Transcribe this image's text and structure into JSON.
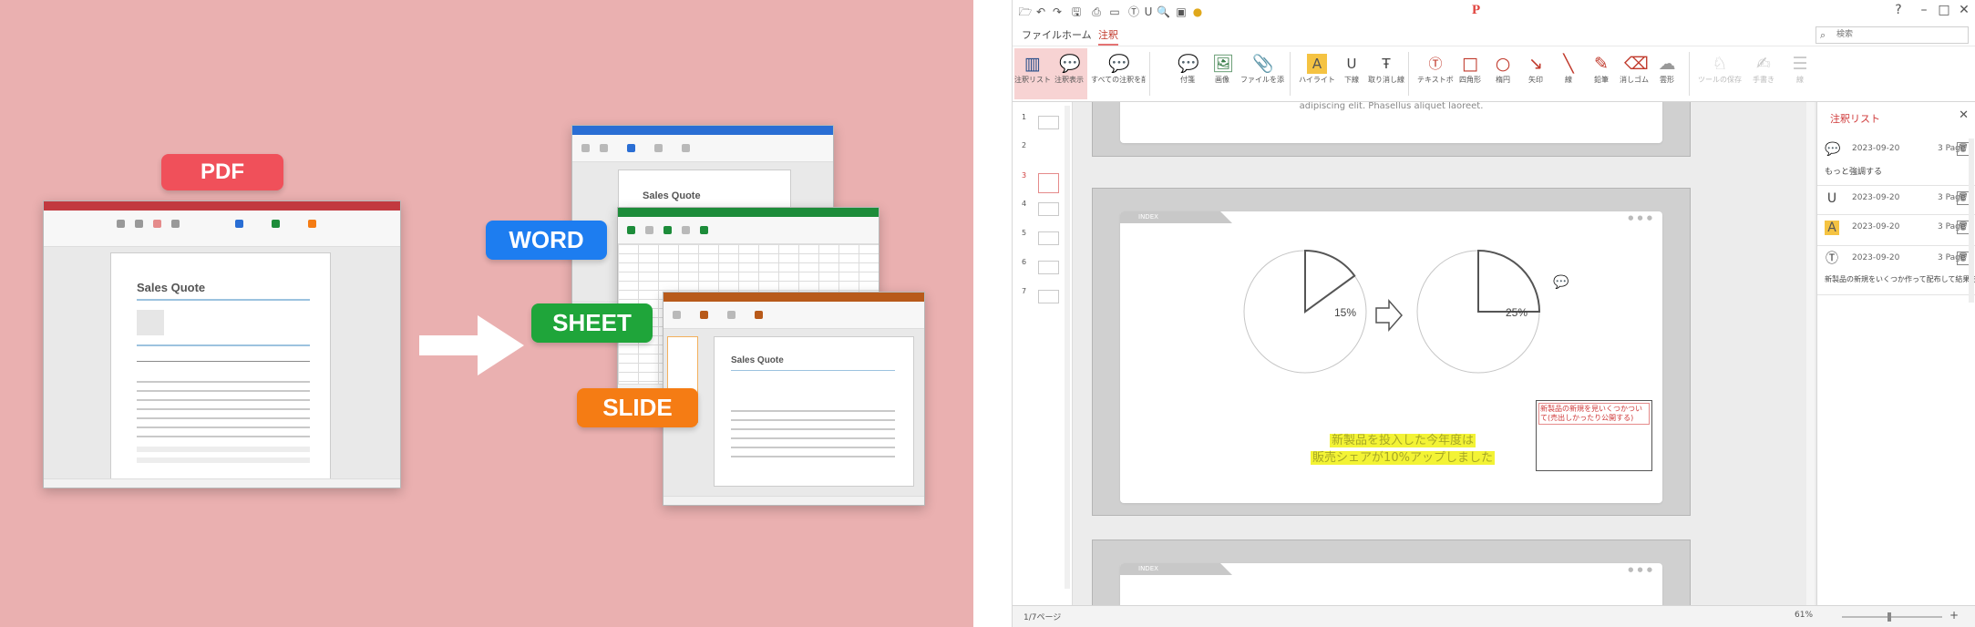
{
  "promo": {
    "badges": {
      "pdf": "PDF",
      "word": "WORD",
      "sheet": "SHEET",
      "slide": "SLIDE"
    },
    "colors": {
      "background": "#eab0b0",
      "pdf": "#f0505a",
      "word": "#1d7df0",
      "sheet": "#1fa53a",
      "slide": "#f57c14"
    },
    "doc_title": "Sales Quote"
  },
  "app": {
    "logo": "P",
    "window_controls": {
      "help": "?",
      "minimize": "–",
      "maximize": "□",
      "close": "✕"
    },
    "tabs": [
      {
        "label": "ファイル"
      },
      {
        "label": "ホーム"
      },
      {
        "label": "注釈"
      }
    ],
    "search_placeholder": "検索",
    "ribbon": [
      {
        "label": "注釈リスト",
        "icon": "annotation-list-icon"
      },
      {
        "label": "注釈表示",
        "icon": "annotation-show-icon"
      },
      {
        "label": "すべての注釈を削除",
        "icon": "delete-all-annotations-icon"
      },
      {
        "label": "付箋",
        "icon": "sticky-note-icon"
      },
      {
        "label": "画像",
        "icon": "image-icon"
      },
      {
        "label": "ファイルを添付",
        "icon": "attach-file-icon"
      },
      {
        "label": "ハイライト",
        "icon": "highlight-icon"
      },
      {
        "label": "下線",
        "icon": "underline-icon"
      },
      {
        "label": "取り消し線",
        "icon": "strikethrough-icon"
      },
      {
        "label": "テキストボックス",
        "icon": "textbox-icon"
      },
      {
        "label": "四角形",
        "icon": "rectangle-icon"
      },
      {
        "label": "楕円",
        "icon": "ellipse-icon"
      },
      {
        "label": "矢印",
        "icon": "arrow-icon"
      },
      {
        "label": "線",
        "icon": "line-icon"
      },
      {
        "label": "鉛筆",
        "icon": "pencil-icon"
      },
      {
        "label": "消しゴム",
        "icon": "eraser-icon"
      },
      {
        "label": "雲形",
        "icon": "cloud-icon"
      },
      {
        "label": "ツールの保存",
        "icon": "tool-save-icon"
      },
      {
        "label": "手書き",
        "icon": "handwriting-icon"
      },
      {
        "label": "線",
        "icon": "line-width-icon"
      }
    ],
    "thumbnails": [
      "1",
      "2",
      "3",
      "4",
      "5",
      "6",
      "7"
    ],
    "selected_thumbnail": "3",
    "viewer": {
      "top_slide_text": "adipiscing elit. Phasellus aliquet laoreet.",
      "slide_header": "INDEX",
      "pie_left_label": "15%",
      "pie_right_label": "25%",
      "highlight_line1": "新製品を投入した今年度は",
      "highlight_line2": "販売シェアが10%アップしました",
      "textbox_text": "新製品の新規を見いくつかついて(売出しかったり公開する)",
      "pie_left_percent": 15,
      "pie_right_percent": 25
    },
    "panel": {
      "title": "注釈リスト",
      "close": "✕",
      "items": [
        {
          "icon": "comment-icon",
          "date": "2023-09-20",
          "page": "3 Page",
          "body": "もっと強調する"
        },
        {
          "icon": "underline-icon",
          "date": "2023-09-20",
          "page": "3 Page",
          "body": ""
        },
        {
          "icon": "highlight-icon",
          "date": "2023-09-20",
          "page": "3 Page",
          "body": ""
        },
        {
          "icon": "textbox-icon",
          "date": "2023-09-20",
          "page": "3 Page",
          "body": "新製品の新規をいくつか作って配布して結果を公開する"
        }
      ]
    },
    "status": {
      "page": "1/7ページ",
      "zoom": "61%",
      "zoom_plus": "+"
    }
  }
}
